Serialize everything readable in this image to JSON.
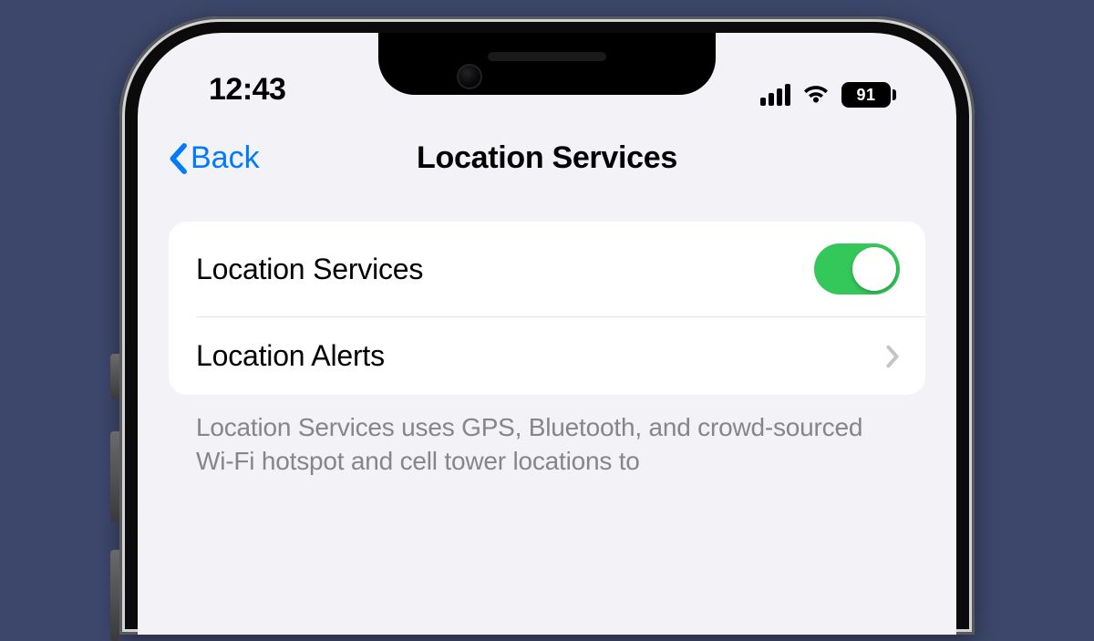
{
  "status": {
    "time": "12:43",
    "battery": "91"
  },
  "nav": {
    "back": "Back",
    "title": "Location Services"
  },
  "rows": {
    "locationServices": "Location Services",
    "locationAlerts": "Location Alerts"
  },
  "toggleState": {
    "locationServices": true
  },
  "footer": "Location Services uses GPS, Bluetooth, and crowd-sourced Wi-Fi hotspot and cell tower locations to"
}
